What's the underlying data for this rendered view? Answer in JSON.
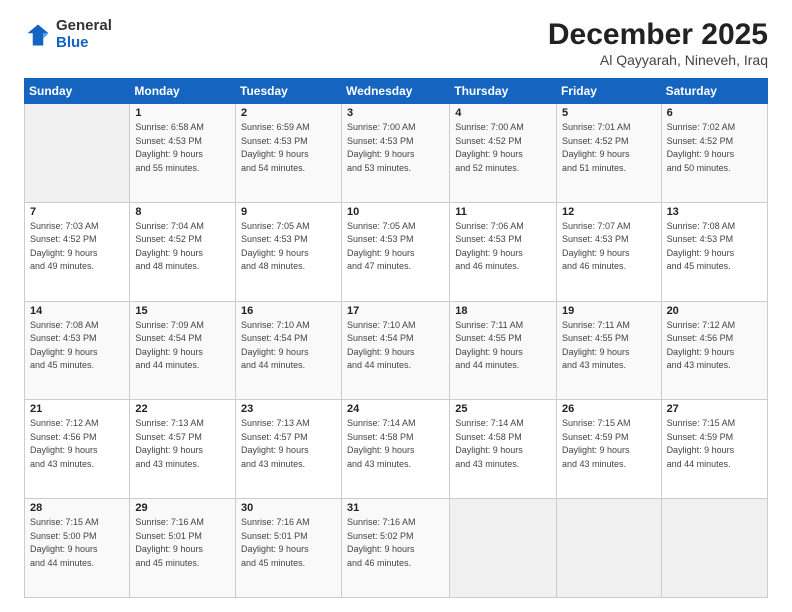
{
  "logo": {
    "general": "General",
    "blue": "Blue"
  },
  "title": "December 2025",
  "subtitle": "Al Qayyarah, Nineveh, Iraq",
  "headers": [
    "Sunday",
    "Monday",
    "Tuesday",
    "Wednesday",
    "Thursday",
    "Friday",
    "Saturday"
  ],
  "weeks": [
    [
      {
        "day": "",
        "info": ""
      },
      {
        "day": "1",
        "info": "Sunrise: 6:58 AM\nSunset: 4:53 PM\nDaylight: 9 hours\nand 55 minutes."
      },
      {
        "day": "2",
        "info": "Sunrise: 6:59 AM\nSunset: 4:53 PM\nDaylight: 9 hours\nand 54 minutes."
      },
      {
        "day": "3",
        "info": "Sunrise: 7:00 AM\nSunset: 4:53 PM\nDaylight: 9 hours\nand 53 minutes."
      },
      {
        "day": "4",
        "info": "Sunrise: 7:00 AM\nSunset: 4:52 PM\nDaylight: 9 hours\nand 52 minutes."
      },
      {
        "day": "5",
        "info": "Sunrise: 7:01 AM\nSunset: 4:52 PM\nDaylight: 9 hours\nand 51 minutes."
      },
      {
        "day": "6",
        "info": "Sunrise: 7:02 AM\nSunset: 4:52 PM\nDaylight: 9 hours\nand 50 minutes."
      }
    ],
    [
      {
        "day": "7",
        "info": "Sunrise: 7:03 AM\nSunset: 4:52 PM\nDaylight: 9 hours\nand 49 minutes."
      },
      {
        "day": "8",
        "info": "Sunrise: 7:04 AM\nSunset: 4:52 PM\nDaylight: 9 hours\nand 48 minutes."
      },
      {
        "day": "9",
        "info": "Sunrise: 7:05 AM\nSunset: 4:53 PM\nDaylight: 9 hours\nand 48 minutes."
      },
      {
        "day": "10",
        "info": "Sunrise: 7:05 AM\nSunset: 4:53 PM\nDaylight: 9 hours\nand 47 minutes."
      },
      {
        "day": "11",
        "info": "Sunrise: 7:06 AM\nSunset: 4:53 PM\nDaylight: 9 hours\nand 46 minutes."
      },
      {
        "day": "12",
        "info": "Sunrise: 7:07 AM\nSunset: 4:53 PM\nDaylight: 9 hours\nand 46 minutes."
      },
      {
        "day": "13",
        "info": "Sunrise: 7:08 AM\nSunset: 4:53 PM\nDaylight: 9 hours\nand 45 minutes."
      }
    ],
    [
      {
        "day": "14",
        "info": "Sunrise: 7:08 AM\nSunset: 4:53 PM\nDaylight: 9 hours\nand 45 minutes."
      },
      {
        "day": "15",
        "info": "Sunrise: 7:09 AM\nSunset: 4:54 PM\nDaylight: 9 hours\nand 44 minutes."
      },
      {
        "day": "16",
        "info": "Sunrise: 7:10 AM\nSunset: 4:54 PM\nDaylight: 9 hours\nand 44 minutes."
      },
      {
        "day": "17",
        "info": "Sunrise: 7:10 AM\nSunset: 4:54 PM\nDaylight: 9 hours\nand 44 minutes."
      },
      {
        "day": "18",
        "info": "Sunrise: 7:11 AM\nSunset: 4:55 PM\nDaylight: 9 hours\nand 44 minutes."
      },
      {
        "day": "19",
        "info": "Sunrise: 7:11 AM\nSunset: 4:55 PM\nDaylight: 9 hours\nand 43 minutes."
      },
      {
        "day": "20",
        "info": "Sunrise: 7:12 AM\nSunset: 4:56 PM\nDaylight: 9 hours\nand 43 minutes."
      }
    ],
    [
      {
        "day": "21",
        "info": "Sunrise: 7:12 AM\nSunset: 4:56 PM\nDaylight: 9 hours\nand 43 minutes."
      },
      {
        "day": "22",
        "info": "Sunrise: 7:13 AM\nSunset: 4:57 PM\nDaylight: 9 hours\nand 43 minutes."
      },
      {
        "day": "23",
        "info": "Sunrise: 7:13 AM\nSunset: 4:57 PM\nDaylight: 9 hours\nand 43 minutes."
      },
      {
        "day": "24",
        "info": "Sunrise: 7:14 AM\nSunset: 4:58 PM\nDaylight: 9 hours\nand 43 minutes."
      },
      {
        "day": "25",
        "info": "Sunrise: 7:14 AM\nSunset: 4:58 PM\nDaylight: 9 hours\nand 43 minutes."
      },
      {
        "day": "26",
        "info": "Sunrise: 7:15 AM\nSunset: 4:59 PM\nDaylight: 9 hours\nand 43 minutes."
      },
      {
        "day": "27",
        "info": "Sunrise: 7:15 AM\nSunset: 4:59 PM\nDaylight: 9 hours\nand 44 minutes."
      }
    ],
    [
      {
        "day": "28",
        "info": "Sunrise: 7:15 AM\nSunset: 5:00 PM\nDaylight: 9 hours\nand 44 minutes."
      },
      {
        "day": "29",
        "info": "Sunrise: 7:16 AM\nSunset: 5:01 PM\nDaylight: 9 hours\nand 45 minutes."
      },
      {
        "day": "30",
        "info": "Sunrise: 7:16 AM\nSunset: 5:01 PM\nDaylight: 9 hours\nand 45 minutes."
      },
      {
        "day": "31",
        "info": "Sunrise: 7:16 AM\nSunset: 5:02 PM\nDaylight: 9 hours\nand 46 minutes."
      },
      {
        "day": "",
        "info": ""
      },
      {
        "day": "",
        "info": ""
      },
      {
        "day": "",
        "info": ""
      }
    ]
  ]
}
